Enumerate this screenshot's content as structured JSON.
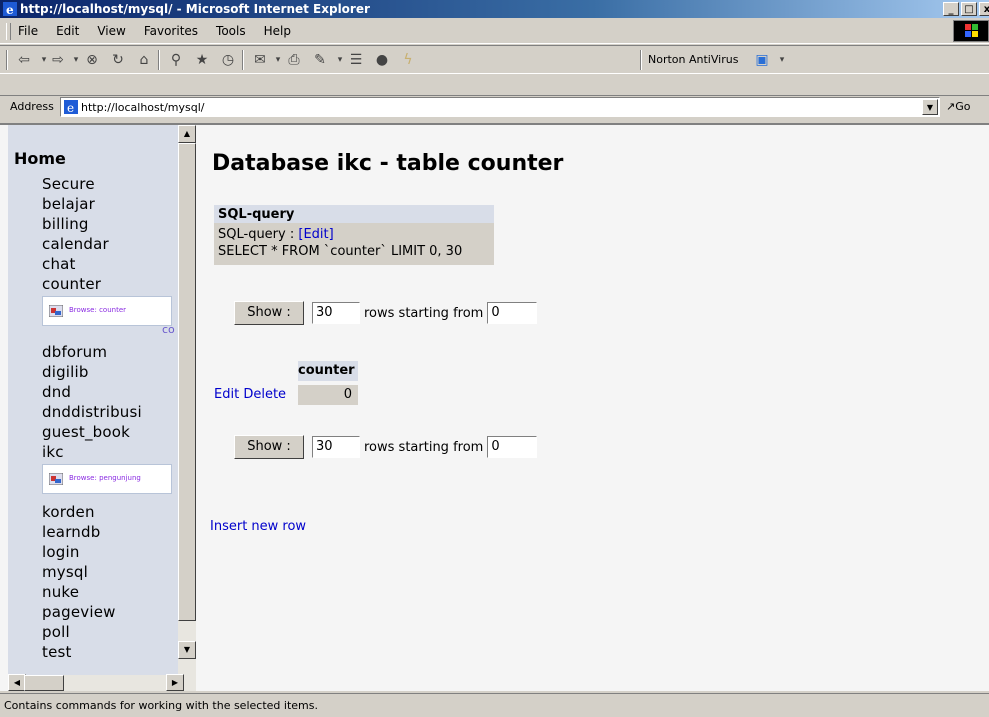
{
  "window": {
    "title": "http://localhost/mysql/ - Microsoft Internet Explorer",
    "buttons": [
      "_",
      "□",
      "x"
    ]
  },
  "menubar": {
    "items": [
      "File",
      "Edit",
      "View",
      "Favorites",
      "Tools",
      "Help"
    ]
  },
  "toolbar": {
    "norton_label": "Norton AntiVirus"
  },
  "address": {
    "label": "Address",
    "url": "http://localhost/mysql/",
    "go_label": "Go"
  },
  "sidebar": {
    "home": "Home",
    "databases_top": [
      "Secure",
      "belajar",
      "billing",
      "calendar",
      "chat",
      "counter"
    ],
    "browse_counter": "Browse: counter",
    "co_label": "co",
    "databases_mid": [
      "dbforum",
      "digilib",
      "dnd",
      "dnddistribusi",
      "guest_book",
      "ikc"
    ],
    "browse_ikc": "Browse: pengunjung",
    "databases_bottom": [
      "korden",
      "learndb",
      "login",
      "mysql",
      "nuke",
      "pageview",
      "poll",
      "test"
    ]
  },
  "main": {
    "title": "Database ikc - table counter",
    "sql_header": "SQL-query",
    "sql_label": "SQL-query : ",
    "sql_edit": "[Edit]",
    "sql_text": "SELECT * FROM `counter` LIMIT 0, 30",
    "show_button": "Show :",
    "rows_value": "30",
    "rows_label": "rows starting from",
    "start_value": "0",
    "table": {
      "column": "counter",
      "edit": "Edit",
      "delete": "Delete",
      "value": "0"
    },
    "insert_link": "Insert new row"
  },
  "statusbar": {
    "text": "Contains commands for working with the selected items."
  }
}
